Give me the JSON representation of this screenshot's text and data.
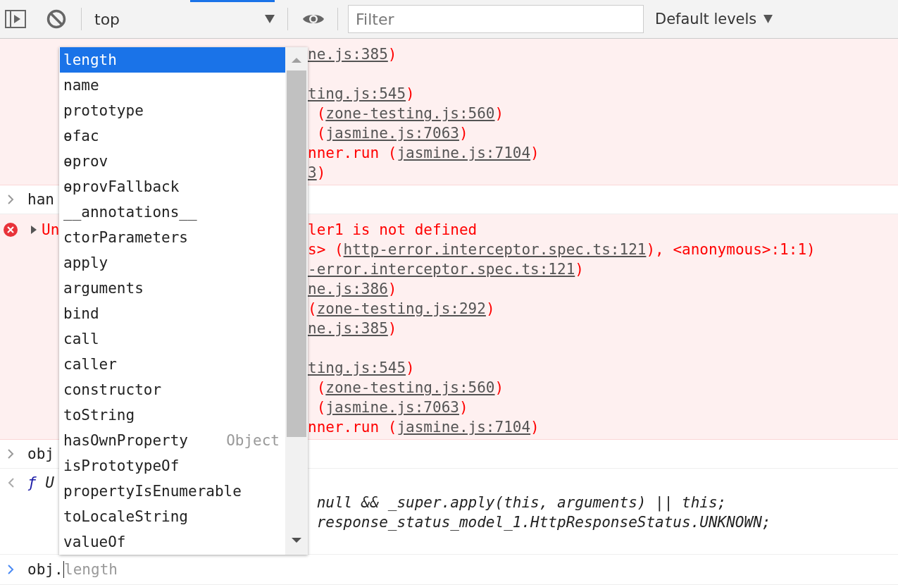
{
  "toolbar": {
    "context": "top",
    "filter": {
      "placeholder": "Filter"
    },
    "levels": "Default levels"
  },
  "console": [
    {
      "kind": "error",
      "lines": [
        {
          "kind": "text",
          "right": [
            {
              "text": "ne.js:385",
              "kind": "link"
            },
            {
              "text": ")",
              "kind": "plain"
            }
          ]
        },
        {
          "kind": "blank"
        },
        {
          "kind": "text",
          "right": [
            {
              "text": "ting.js:545",
              "kind": "link"
            },
            {
              "text": ")",
              "kind": "plain"
            }
          ]
        },
        {
          "kind": "text",
          "right": [
            {
              "text": " (",
              "kind": "plain"
            },
            {
              "text": "zone-testing.js:560",
              "kind": "link"
            },
            {
              "text": ")",
              "kind": "plain"
            }
          ]
        },
        {
          "kind": "text",
          "right": [
            {
              "text": " (",
              "kind": "plain"
            },
            {
              "text": "jasmine.js:7063",
              "kind": "link"
            },
            {
              "text": ")",
              "kind": "plain"
            }
          ]
        },
        {
          "kind": "text",
          "right": [
            {
              "text": "nner.run (",
              "kind": "plain"
            },
            {
              "text": "jasmine.js:7104",
              "kind": "link"
            },
            {
              "text": ")",
              "kind": "plain"
            }
          ]
        },
        {
          "kind": "text",
          "right": [
            {
              "text": "3",
              "kind": "link"
            },
            {
              "text": ")",
              "kind": "plain"
            }
          ]
        }
      ]
    },
    {
      "kind": "input",
      "text": "han"
    },
    {
      "kind": "error",
      "error_icon": true,
      "expanded": false,
      "lines": [
        {
          "kind": "text",
          "left": [
            {
              "text": "Un",
              "kind": "plain"
            }
          ],
          "right": [
            {
              "text": "ler1 is not defined",
              "kind": "plain"
            }
          ]
        },
        {
          "kind": "text",
          "right": [
            {
              "text": "s> (",
              "kind": "plain"
            },
            {
              "text": "http-error.interceptor.spec.ts:121",
              "kind": "link"
            },
            {
              "text": "), <anonymous>:1:1)",
              "kind": "plain"
            }
          ]
        },
        {
          "kind": "text",
          "right": [
            {
              "text": "-error.interceptor.spec.ts:121",
              "kind": "link"
            },
            {
              "text": ")",
              "kind": "plain"
            }
          ]
        },
        {
          "kind": "text",
          "right": [
            {
              "text": "ne.js:386",
              "kind": "link"
            },
            {
              "text": ")",
              "kind": "plain"
            }
          ]
        },
        {
          "kind": "text",
          "right": [
            {
              "text": "(",
              "kind": "plain"
            },
            {
              "text": "zone-testing.js:292",
              "kind": "link"
            },
            {
              "text": ")",
              "kind": "plain"
            }
          ]
        },
        {
          "kind": "text",
          "right": [
            {
              "text": "ne.js:385",
              "kind": "link"
            },
            {
              "text": ")",
              "kind": "plain"
            }
          ]
        },
        {
          "kind": "blank"
        },
        {
          "kind": "text",
          "right": [
            {
              "text": "ting.js:545",
              "kind": "link"
            },
            {
              "text": ")",
              "kind": "plain"
            }
          ]
        },
        {
          "kind": "text",
          "right": [
            {
              "text": " (",
              "kind": "plain"
            },
            {
              "text": "zone-testing.js:560",
              "kind": "link"
            },
            {
              "text": ")",
              "kind": "plain"
            }
          ]
        },
        {
          "kind": "text",
          "right": [
            {
              "text": " (",
              "kind": "plain"
            },
            {
              "text": "jasmine.js:7063",
              "kind": "link"
            },
            {
              "text": ")",
              "kind": "plain"
            }
          ]
        },
        {
          "kind": "text",
          "right": [
            {
              "text": "nner.run (",
              "kind": "plain"
            },
            {
              "text": "jasmine.js:7104",
              "kind": "link"
            },
            {
              "text": ")",
              "kind": "plain"
            }
          ]
        }
      ]
    },
    {
      "kind": "input",
      "text": "obj"
    },
    {
      "kind": "result",
      "lines": [
        {
          "kind": "text",
          "left": [
            {
              "text": "ƒ",
              "kind": "fn"
            },
            {
              "text": " U",
              "kind": "plain"
            }
          ]
        },
        {
          "kind": "text",
          "right": [
            {
              "text": " null && _super.apply(this, arguments) || this;",
              "kind": "plain"
            }
          ]
        },
        {
          "kind": "text",
          "right": [
            {
              "text": " response_status_model_1.HttpResponseStatus.UNKNOWN;",
              "kind": "plain"
            }
          ]
        }
      ]
    },
    {
      "kind": "prompt",
      "text": "obj.",
      "suggestion": "length"
    }
  ],
  "autocomplete": [
    {
      "label": "length",
      "selected": true
    },
    {
      "label": "name",
      "selected": false
    },
    {
      "label": "prototype",
      "selected": false
    },
    {
      "label": "ɵfac",
      "selected": false
    },
    {
      "label": "ɵprov",
      "selected": false
    },
    {
      "label": "ɵprovFallback",
      "selected": false
    },
    {
      "label": "__annotations__",
      "selected": false
    },
    {
      "label": "ctorParameters",
      "selected": false
    },
    {
      "label": "apply",
      "selected": false
    },
    {
      "label": "arguments",
      "selected": false
    },
    {
      "label": "bind",
      "selected": false
    },
    {
      "label": "call",
      "selected": false
    },
    {
      "label": "caller",
      "selected": false
    },
    {
      "label": "constructor",
      "selected": false
    },
    {
      "label": "toString",
      "selected": false
    },
    {
      "label": "hasOwnProperty",
      "selected": false,
      "hint": "Object"
    },
    {
      "label": "isPrototypeOf",
      "selected": false
    },
    {
      "label": "propertyIsEnumerable",
      "selected": false
    },
    {
      "label": "toLocaleString",
      "selected": false
    },
    {
      "label": "valueOf",
      "selected": false
    }
  ]
}
